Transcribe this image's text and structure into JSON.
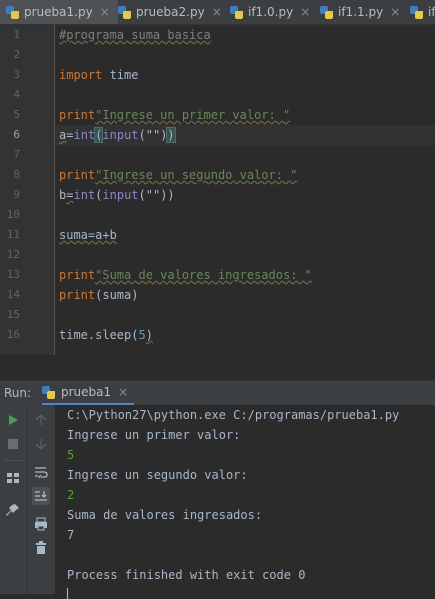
{
  "tabs": [
    {
      "label": "prueba1.py",
      "close": "×",
      "active": true
    },
    {
      "label": "prueba2.py",
      "close": "×",
      "active": false
    },
    {
      "label": "if1.0.py",
      "close": "×",
      "active": false
    },
    {
      "label": "if1.1.py",
      "close": "×",
      "active": false
    },
    {
      "label": "if",
      "close": "",
      "active": false
    }
  ],
  "editor": {
    "current_line": 6,
    "line_numbers": [
      "1",
      "2",
      "3",
      "4",
      "5",
      "6",
      "7",
      "8",
      "9",
      "10",
      "11",
      "12",
      "13",
      "14",
      "15",
      "16"
    ],
    "code": {
      "l1": "#programa suma basica",
      "l3_kw": "import",
      "l3_rest": " time",
      "l5_kw": "print",
      "l5_str": "\"Ingrese un primer valor: \"",
      "l6_a": "a",
      "l6_eq": "=",
      "l6_int": "int",
      "l6_open": "(",
      "l6_input": "input",
      "l6_mid": "(\"\")",
      "l6_close": ")",
      "l8_kw": "print",
      "l8_str": "\"Ingrese un segundo valor: \"",
      "l9_b": "b",
      "l9_eq": "=",
      "l9_int": "int",
      "l9_rest1": "(",
      "l9_input": "input",
      "l9_rest2": "(\"\"))",
      "l11": "suma=a+b",
      "l13_kw": "print",
      "l13_str": "\"Suma de valores ingresados: \"",
      "l14_kw": "print",
      "l14_rest": "(suma)",
      "l16_a": "time.sleep(",
      "l16_num": "5",
      "l16_b": ")"
    }
  },
  "run": {
    "label": "Run:",
    "tab_label": "prueba1",
    "tab_close": "×",
    "console_lines": [
      {
        "text": "C:\\Python27\\python.exe C:/programas/prueba1.py",
        "kind": "out"
      },
      {
        "text": "Ingrese un primer valor:",
        "kind": "out"
      },
      {
        "text": "5",
        "kind": "in"
      },
      {
        "text": "Ingrese un segundo valor:",
        "kind": "out"
      },
      {
        "text": "2",
        "kind": "in"
      },
      {
        "text": "Suma de valores ingresados:",
        "kind": "out"
      },
      {
        "text": "7",
        "kind": "out"
      },
      {
        "text": "",
        "kind": "out"
      },
      {
        "text": "Process finished with exit code 0",
        "kind": "out"
      }
    ],
    "toolbar_icons": [
      "run-icon",
      "stop-icon",
      "layout-icon",
      "pin-icon",
      "up-arrow-icon",
      "down-arrow-icon",
      "soft-wrap-icon",
      "scroll-to-end-icon",
      "print-icon",
      "trash-icon"
    ]
  },
  "colors": {
    "background": "#2b2b2b",
    "keyword": "#cc7832",
    "string": "#6a8759",
    "number": "#6897bb",
    "comment": "#808080",
    "input_text": "#589e35",
    "run_green": "#499c54"
  }
}
